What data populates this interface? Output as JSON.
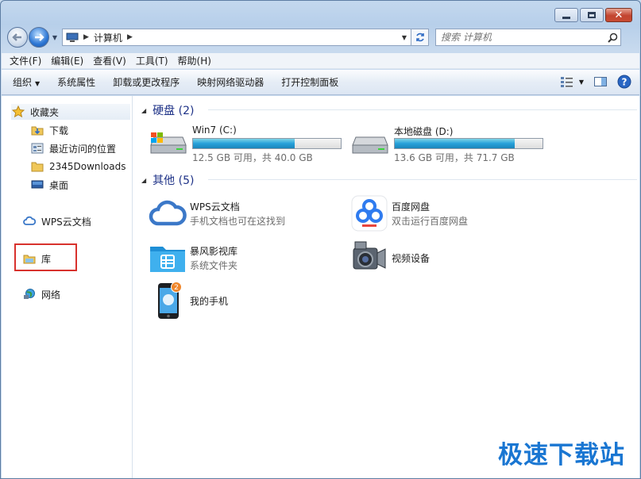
{
  "address": {
    "root_label": "计算机"
  },
  "search": {
    "placeholder": "搜索 计算机"
  },
  "menu": [
    "文件(F)",
    "编辑(E)",
    "查看(V)",
    "工具(T)",
    "帮助(H)"
  ],
  "commands": {
    "organize": "组织",
    "items": [
      "系统属性",
      "卸载或更改程序",
      "映射网络驱动器",
      "打开控制面板"
    ]
  },
  "sidebar": {
    "favorites": "收藏夹",
    "fav_items": [
      "下载",
      "最近访问的位置",
      "2345Downloads",
      "桌面"
    ],
    "wps": "WPS云文档",
    "library": "库",
    "network": "网络"
  },
  "groups": {
    "drives": "硬盘 (2)",
    "others": "其他 (5)"
  },
  "drives": [
    {
      "name": "Win7 (C:)",
      "info": "12.5 GB 可用，共 40.0 GB",
      "used_fraction": 0.69
    },
    {
      "name": "本地磁盘 (D:)",
      "info": "13.6 GB 可用，共 71.7 GB",
      "used_fraction": 0.81
    }
  ],
  "others": [
    {
      "name": "WPS云文档",
      "sub": "手机文档也可在这找到",
      "icon": "cloud-icon"
    },
    {
      "name": "百度网盘",
      "sub": "双击运行百度网盘",
      "icon": "baidu-netdisk-icon"
    },
    {
      "name": "暴风影视库",
      "sub": "系统文件夹",
      "icon": "media-folder-icon"
    },
    {
      "name": "视频设备",
      "sub": "",
      "icon": "camera-icon"
    },
    {
      "name": "我的手机",
      "sub": "",
      "icon": "phone-icon",
      "badge": "2"
    }
  ],
  "watermark": "极速下载站",
  "colors": {
    "accent": "#26a0da",
    "group_header": "#1e3287",
    "highlight": "#d8322d"
  }
}
